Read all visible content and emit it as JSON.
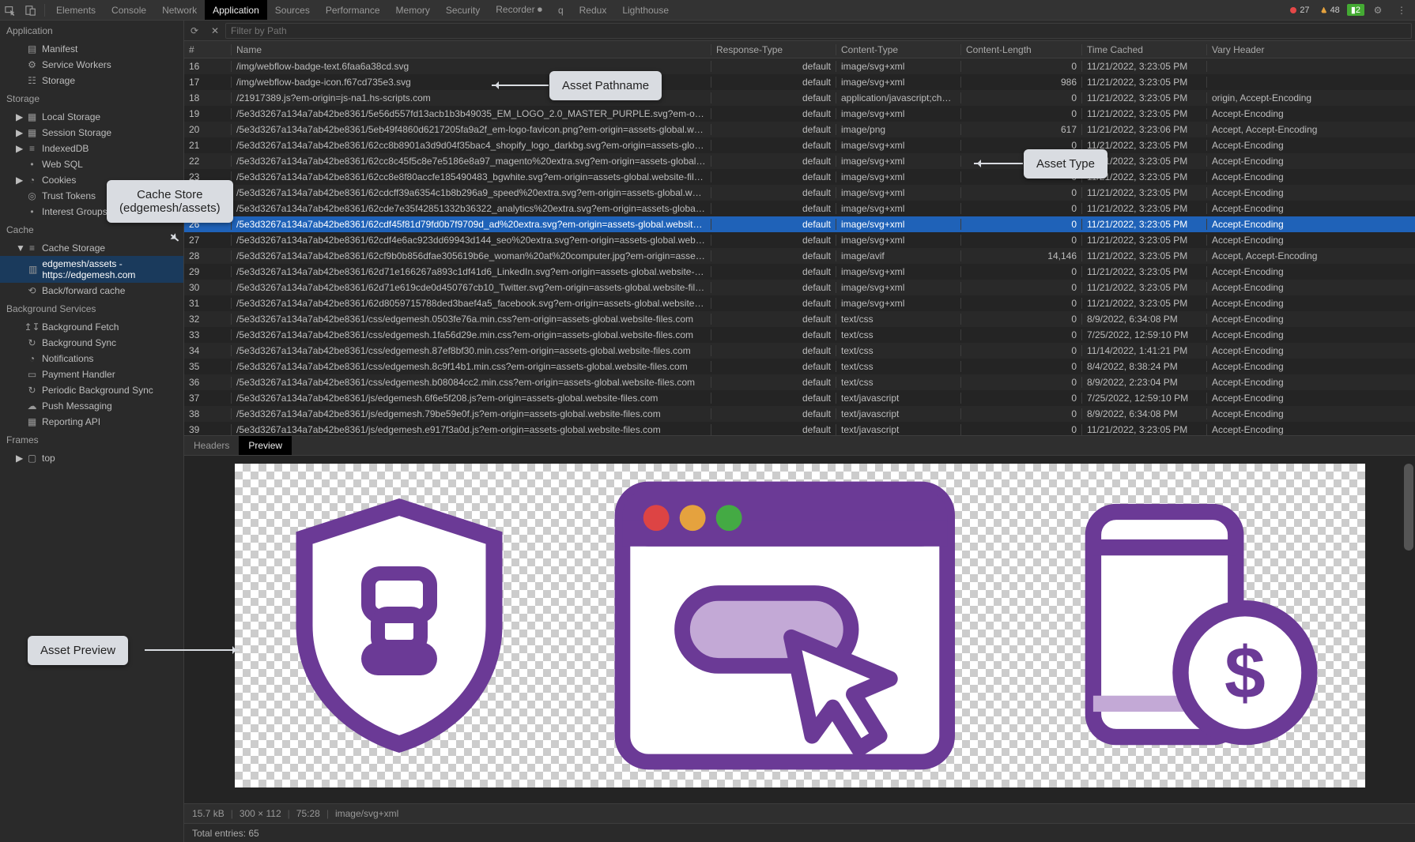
{
  "top": {
    "tabs": [
      "Elements",
      "Console",
      "Network",
      "Application",
      "Sources",
      "Performance",
      "Memory",
      "Security",
      "Recorder ⏺︎",
      "q",
      "Redux",
      "Lighthouse"
    ],
    "activeTab": "Application",
    "errorCount": "27",
    "warnCount": "48",
    "infoCount": "2"
  },
  "sidebar": {
    "sections": [
      {
        "title": "Application",
        "items": [
          {
            "icon": "file",
            "label": "Manifest"
          },
          {
            "icon": "gear",
            "label": "Service Workers"
          },
          {
            "icon": "db-sm",
            "label": "Storage"
          }
        ]
      },
      {
        "title": "Storage",
        "items": [
          {
            "icon": "localstorage",
            "label": "Local Storage",
            "arrow": true
          },
          {
            "icon": "localstorage",
            "label": "Session Storage",
            "arrow": true
          },
          {
            "icon": "db",
            "label": "IndexedDB",
            "arrow": true
          },
          {
            "icon": "none",
            "label": "Web SQL"
          },
          {
            "icon": "cookie",
            "label": "Cookies",
            "arrow": true
          },
          {
            "icon": "token",
            "label": "Trust Tokens"
          },
          {
            "icon": "none",
            "label": "Interest Groups"
          }
        ]
      },
      {
        "title": "Cache",
        "items": [
          {
            "icon": "db",
            "label": "Cache Storage",
            "arrow": true,
            "expanded": true,
            "children": [
              {
                "icon": "grid",
                "label": "edgemesh/assets - https://edgemesh.com",
                "selected": true
              }
            ]
          },
          {
            "icon": "bfcache",
            "label": "Back/forward cache"
          }
        ]
      },
      {
        "title": "Background Services",
        "items": [
          {
            "icon": "bgfetch",
            "label": "Background Fetch"
          },
          {
            "icon": "sync",
            "label": "Background Sync"
          },
          {
            "icon": "bell",
            "label": "Notifications"
          },
          {
            "icon": "card",
            "label": "Payment Handler"
          },
          {
            "icon": "sync",
            "label": "Periodic Background Sync"
          },
          {
            "icon": "cloud",
            "label": "Push Messaging"
          },
          {
            "icon": "report",
            "label": "Reporting API"
          }
        ]
      },
      {
        "title": "Frames",
        "items": [
          {
            "icon": "frame",
            "label": "top",
            "arrow": true
          }
        ]
      }
    ]
  },
  "filterPlaceholder": "Filter by Path",
  "columns": [
    "#",
    "Name",
    "Response-Type",
    "Content-Type",
    "Content-Length",
    "Time Cached",
    "Vary Header"
  ],
  "rows": [
    {
      "n": "16",
      "name": "/img/webflow-badge-text.6faa6a38cd.svg",
      "resp": "default",
      "ctype": "image/svg+xml",
      "clen": "0",
      "time": "11/21/2022, 3:23:05 PM",
      "vary": ""
    },
    {
      "n": "17",
      "name": "/img/webflow-badge-icon.f67cd735e3.svg",
      "resp": "default",
      "ctype": "image/svg+xml",
      "clen": "986",
      "time": "11/21/2022, 3:23:05 PM",
      "vary": ""
    },
    {
      "n": "18",
      "name": "/21917389.js?em-origin=js-na1.hs-scripts.com",
      "resp": "default",
      "ctype": "application/javascript;ch…",
      "clen": "0",
      "time": "11/21/2022, 3:23:05 PM",
      "vary": "origin, Accept-Encoding"
    },
    {
      "n": "19",
      "name": "/5e3d3267a134a7ab42be8361/5e56d557fd13acb1b3b49035_EM_LOGO_2.0_MASTER_PURPLE.svg?em-origi…",
      "resp": "default",
      "ctype": "image/svg+xml",
      "clen": "0",
      "time": "11/21/2022, 3:23:05 PM",
      "vary": "Accept-Encoding"
    },
    {
      "n": "20",
      "name": "/5e3d3267a134a7ab42be8361/5eb49f4860d6217205fa9a2f_em-logo-favicon.png?em-origin=assets-global.we…",
      "resp": "default",
      "ctype": "image/png",
      "clen": "617",
      "time": "11/21/2022, 3:23:06 PM",
      "vary": "Accept, Accept-Encoding"
    },
    {
      "n": "21",
      "name": "/5e3d3267a134a7ab42be8361/62cc8b8901a3d9d04f35bac4_shopify_logo_darkbg.svg?em-origin=assets-glob…",
      "resp": "default",
      "ctype": "image/svg+xml",
      "clen": "0",
      "time": "11/21/2022, 3:23:05 PM",
      "vary": "Accept-Encoding"
    },
    {
      "n": "22",
      "name": "/5e3d3267a134a7ab42be8361/62cc8c45f5c8e7e5186e8a97_magento%20extra.svg?em-origin=assets-global.we…",
      "resp": "default",
      "ctype": "image/svg+xml",
      "clen": "0",
      "time": "11/21/2022, 3:23:05 PM",
      "vary": "Accept-Encoding"
    },
    {
      "n": "23",
      "name": "/5e3d3267a134a7ab42be8361/62cc8e8f80accfe185490483_bgwhite.svg?em-origin=assets-global.website-files…",
      "resp": "default",
      "ctype": "image/svg+xml",
      "clen": "0",
      "time": "11/21/2022, 3:23:05 PM",
      "vary": "Accept-Encoding"
    },
    {
      "n": "24",
      "name": "/5e3d3267a134a7ab42be8361/62cdcff39a6354c1b8b296a9_speed%20extra.svg?em-origin=assets-global.webs…",
      "resp": "default",
      "ctype": "image/svg+xml",
      "clen": "0",
      "time": "11/21/2022, 3:23:05 PM",
      "vary": "Accept-Encoding"
    },
    {
      "n": "25",
      "name": "/5e3d3267a134a7ab42be8361/62cde7e35f42851332b36322_analytics%20extra.svg?em-origin=assets-global…",
      "resp": "default",
      "ctype": "image/svg+xml",
      "clen": "0",
      "time": "11/21/2022, 3:23:05 PM",
      "vary": "Accept-Encoding"
    },
    {
      "n": "26",
      "name": "/5e3d3267a134a7ab42be8361/62cdf45f81d79fd0b7f9709d_ad%20extra.svg?em-origin=assets-global.website-…",
      "resp": "default",
      "ctype": "image/svg+xml",
      "clen": "0",
      "time": "11/21/2022, 3:23:05 PM",
      "vary": "Accept-Encoding",
      "selected": true
    },
    {
      "n": "27",
      "name": "/5e3d3267a134a7ab42be8361/62cdf4e6ac923dd69943d144_seo%20extra.svg?em-origin=assets-global.websi…",
      "resp": "default",
      "ctype": "image/svg+xml",
      "clen": "0",
      "time": "11/21/2022, 3:23:05 PM",
      "vary": "Accept-Encoding"
    },
    {
      "n": "28",
      "name": "/5e3d3267a134a7ab42be8361/62cf9b0b856dfae305619b6e_woman%20at%20computer.jpg?em-origin=assets…",
      "resp": "default",
      "ctype": "image/avif",
      "clen": "14,146",
      "time": "11/21/2022, 3:23:05 PM",
      "vary": "Accept, Accept-Encoding"
    },
    {
      "n": "29",
      "name": "/5e3d3267a134a7ab42be8361/62d71e166267a893c1df41d6_LinkedIn.svg?em-origin=assets-global.website-fil…",
      "resp": "default",
      "ctype": "image/svg+xml",
      "clen": "0",
      "time": "11/21/2022, 3:23:05 PM",
      "vary": "Accept-Encoding"
    },
    {
      "n": "30",
      "name": "/5e3d3267a134a7ab42be8361/62d71e619cde0d450767cb10_Twitter.svg?em-origin=assets-global.website-files…",
      "resp": "default",
      "ctype": "image/svg+xml",
      "clen": "0",
      "time": "11/21/2022, 3:23:05 PM",
      "vary": "Accept-Encoding"
    },
    {
      "n": "31",
      "name": "/5e3d3267a134a7ab42be8361/62d8059715788ded3baef4a5_facebook.svg?em-origin=assets-global.website-fi…",
      "resp": "default",
      "ctype": "image/svg+xml",
      "clen": "0",
      "time": "11/21/2022, 3:23:05 PM",
      "vary": "Accept-Encoding"
    },
    {
      "n": "32",
      "name": "/5e3d3267a134a7ab42be8361/css/edgemesh.0503fe76a.min.css?em-origin=assets-global.website-files.com",
      "resp": "default",
      "ctype": "text/css",
      "clen": "0",
      "time": "8/9/2022, 6:34:08 PM",
      "vary": "Accept-Encoding"
    },
    {
      "n": "33",
      "name": "/5e3d3267a134a7ab42be8361/css/edgemesh.1fa56d29e.min.css?em-origin=assets-global.website-files.com",
      "resp": "default",
      "ctype": "text/css",
      "clen": "0",
      "time": "7/25/2022, 12:59:10 PM",
      "vary": "Accept-Encoding"
    },
    {
      "n": "34",
      "name": "/5e3d3267a134a7ab42be8361/css/edgemesh.87ef8bf30.min.css?em-origin=assets-global.website-files.com",
      "resp": "default",
      "ctype": "text/css",
      "clen": "0",
      "time": "11/14/2022, 1:41:21 PM",
      "vary": "Accept-Encoding"
    },
    {
      "n": "35",
      "name": "/5e3d3267a134a7ab42be8361/css/edgemesh.8c9f14b1.min.css?em-origin=assets-global.website-files.com",
      "resp": "default",
      "ctype": "text/css",
      "clen": "0",
      "time": "8/4/2022, 8:38:24 PM",
      "vary": "Accept-Encoding"
    },
    {
      "n": "36",
      "name": "/5e3d3267a134a7ab42be8361/css/edgemesh.b08084cc2.min.css?em-origin=assets-global.website-files.com",
      "resp": "default",
      "ctype": "text/css",
      "clen": "0",
      "time": "8/9/2022, 2:23:04 PM",
      "vary": "Accept-Encoding"
    },
    {
      "n": "37",
      "name": "/5e3d3267a134a7ab42be8361/js/edgemesh.6f6e5f208.js?em-origin=assets-global.website-files.com",
      "resp": "default",
      "ctype": "text/javascript",
      "clen": "0",
      "time": "7/25/2022, 12:59:10 PM",
      "vary": "Accept-Encoding"
    },
    {
      "n": "38",
      "name": "/5e3d3267a134a7ab42be8361/js/edgemesh.79be59e0f.js?em-origin=assets-global.website-files.com",
      "resp": "default",
      "ctype": "text/javascript",
      "clen": "0",
      "time": "8/9/2022, 6:34:08 PM",
      "vary": "Accept-Encoding"
    },
    {
      "n": "39",
      "name": "/5e3d3267a134a7ab42be8361/js/edgemesh.e917f3a0d.js?em-origin=assets-global.website-files.com",
      "resp": "default",
      "ctype": "text/javascript",
      "clen": "0",
      "time": "11/21/2022, 3:23:05 PM",
      "vary": "Accept-Encoding"
    }
  ],
  "subTabs": [
    "Headers",
    "Preview"
  ],
  "activeSubTab": "Preview",
  "status": {
    "size": "15.7 kB",
    "dim": "300 × 112",
    "ratio": "75:28",
    "mime": "image/svg+xml"
  },
  "footer": "Total entries: 65",
  "annotations": {
    "cacheStore": "Cache Store\n(edgemesh/assets)",
    "assetPathname": "Asset Pathname",
    "assetType": "Asset Type",
    "assetPreview": "Asset Preview"
  }
}
